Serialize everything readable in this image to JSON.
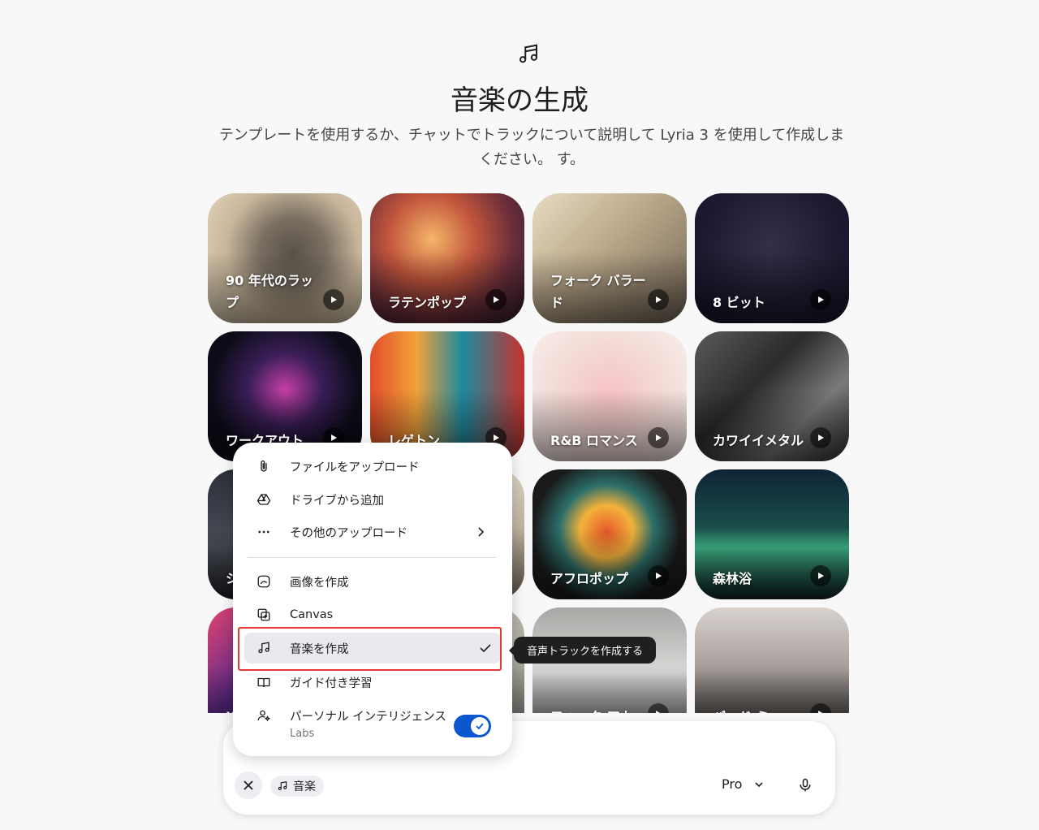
{
  "header": {
    "icon": "music-note-icon",
    "title": "音楽の生成",
    "subtitle_line1": "テンプレートを使用するか、チャットでトラックについて説明して Lyria 3 を使用して作成しま",
    "subtitle_line2": "ください。 す。"
  },
  "templates": [
    {
      "label": "90 年代のラップ"
    },
    {
      "label": "ラテンポップ"
    },
    {
      "label": "フォーク バラード"
    },
    {
      "label": "8 ビット"
    },
    {
      "label": "ワークアウト"
    },
    {
      "label": "レゲトン"
    },
    {
      "label": "R&B ロマンス"
    },
    {
      "label": "カワイイメタル"
    },
    {
      "label": "シ ク"
    },
    {
      "label": ""
    },
    {
      "label": "アフロポップ"
    },
    {
      "label": "森林浴"
    },
    {
      "label": "K"
    },
    {
      "label": ""
    },
    {
      "label": "フォーク アカ"
    },
    {
      "label": "バッド ミュー"
    }
  ],
  "menu": {
    "upload_file": "ファイルをアップロード",
    "add_from_drive": "ドライブから追加",
    "other_uploads": "その他のアップロード",
    "create_image": "画像を作成",
    "canvas": "Canvas",
    "create_music": "音楽を作成",
    "guided_learning": "ガイド付き学習",
    "personal_intelligence": "パーソナル インテリジェンス",
    "personal_intelligence_sub": "Labs",
    "personal_intelligence_enabled": true
  },
  "tooltip": {
    "text": "音声トラックを作成する"
  },
  "composer": {
    "chip_label": "音楽",
    "model_label": "Pro"
  },
  "colors": {
    "accent": "#0b57d0",
    "highlight_border": "#e53935",
    "tooltip_bg": "#1f1f1f"
  }
}
